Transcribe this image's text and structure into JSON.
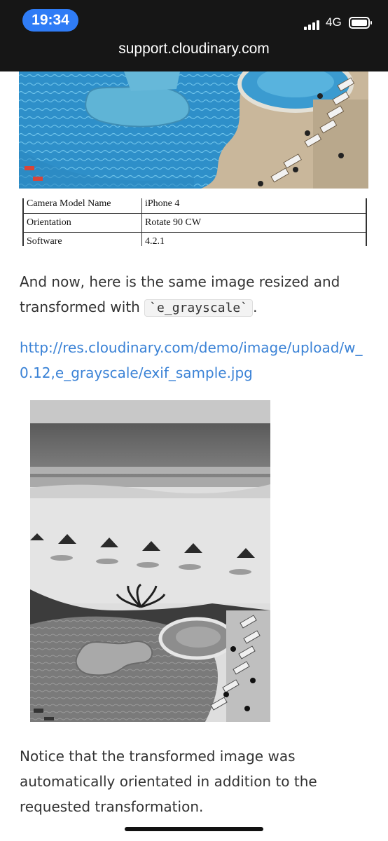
{
  "status_bar": {
    "time": "19:34",
    "network": "4G",
    "icons": [
      "signal-icon",
      "battery-icon"
    ]
  },
  "browser": {
    "url": "support.cloudinary.com"
  },
  "exif_table": {
    "rows": [
      {
        "label": "Camera Model Name",
        "value": "iPhone 4"
      },
      {
        "label": "Orientation",
        "value": "Rotate 90 CW"
      },
      {
        "label": "Software",
        "value": "4.2.1"
      }
    ]
  },
  "article": {
    "intro_before": "And now, here is the same image resized and transformed with ",
    "intro_code": "`e_grayscale`",
    "intro_after": ".",
    "link_text": "http://res.cloudinary.com/demo/image/upload/w_0.12,e_grayscale/exif_sample.jpg",
    "note": "Notice that the transformed image was automatically orientated in addition to the requested transformation."
  },
  "colors": {
    "accent_time_pill": "#2f7cf6",
    "link": "#3a82d6",
    "topbar": "#161616"
  }
}
